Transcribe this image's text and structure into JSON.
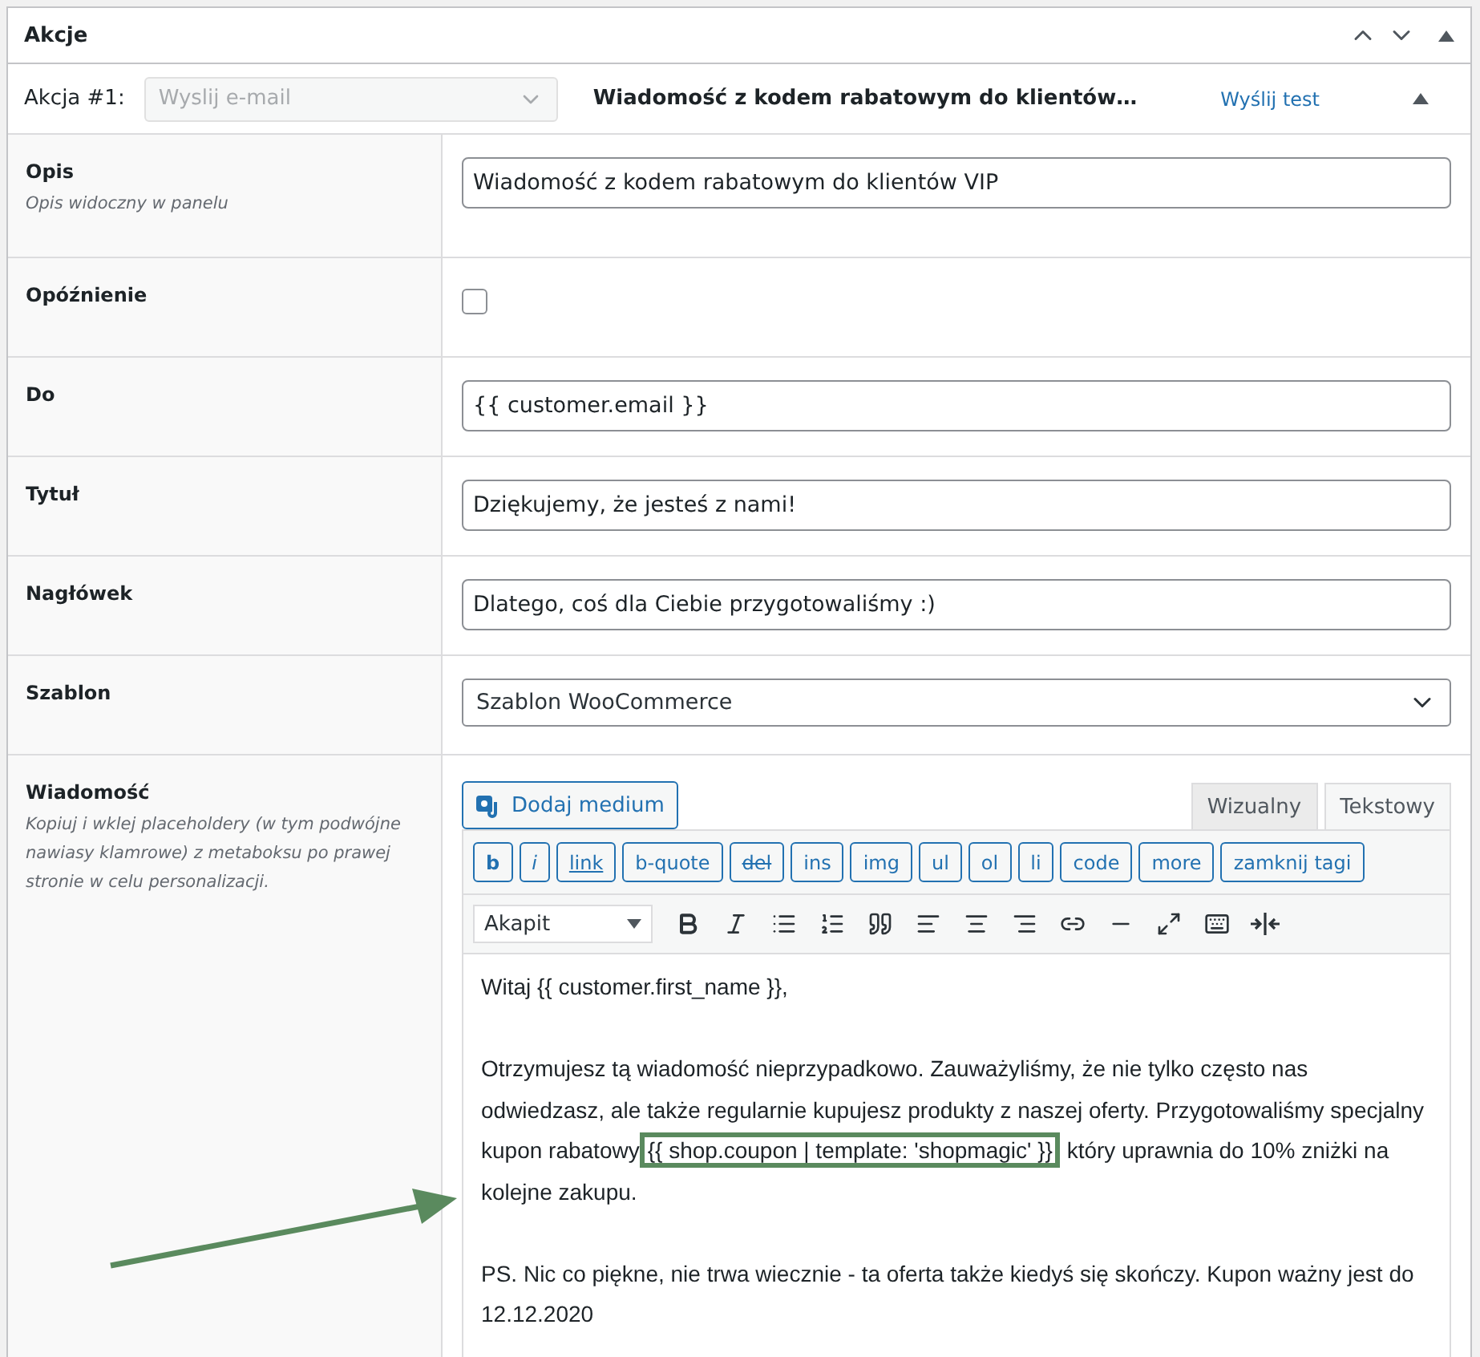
{
  "panel": {
    "title": "Akcje"
  },
  "action": {
    "label": "Akcja #1:",
    "type_select": {
      "value": "Wyslij e-mail",
      "disabled": true
    },
    "title": "Wiadomość z kodem rabatowym do klientów…",
    "send_test": "Wyślij test"
  },
  "fields": [
    {
      "kind": "text",
      "label": "Opis",
      "hint": "Opis widoczny w panelu",
      "value": "Wiadomość z kodem rabatowym do klientów VIP"
    },
    {
      "kind": "checkbox",
      "label": "Opóźnienie",
      "checked": false
    },
    {
      "kind": "text",
      "label": "Do",
      "value": "{{ customer.email }}"
    },
    {
      "kind": "text",
      "label": "Tytuł",
      "value": "Dziękujemy, że jesteś z nami!"
    },
    {
      "kind": "text",
      "label": "Nagłówek",
      "value": "Dlatego, coś dla Ciebie przygotowaliśmy :)"
    },
    {
      "kind": "select",
      "label": "Szablon",
      "value": "Szablon WooCommerce"
    }
  ],
  "message": {
    "label": "Wiadomość",
    "hint": "Kopiuj i wklej placeholdery (w tym podwójne nawiasy klamrowe) z metaboksu po prawej stronie w celu personalizacji.",
    "add_media": "Dodaj medium",
    "tabs": [
      {
        "label": "Wizualny",
        "selected": false
      },
      {
        "label": "Tekstowy",
        "selected": true
      }
    ],
    "quicktags": [
      "b",
      "i",
      "link",
      "b-quote",
      "del",
      "ins",
      "img",
      "ul",
      "ol",
      "li",
      "code",
      "more",
      "zamknij tagi"
    ],
    "format_select": "Akapit",
    "body": [
      {
        "kind": "line",
        "text": "Witaj {{ customer.first_name }},"
      },
      {
        "kind": "highlighted",
        "before": "Otrzymujesz tą wiadomość nieprzypadkowo. Zauważyliśmy, że nie tylko często nas odwiedzasz, ale także regularnie kupujesz produkty z naszej oferty. Przygotowaliśmy specjalny kupon rabatowy",
        "highlight": "{{ shop.coupon | template: 'shopmagic' }}",
        "after": " który uprawnia do 10% zniżki na kolejne zakupu."
      },
      {
        "kind": "line",
        "text": "PS. Nic co piękne, nie trwa wiecznie - ta oferta także kiedyś się skończy. Kupon ważny jest do 12.12.2020"
      }
    ]
  }
}
